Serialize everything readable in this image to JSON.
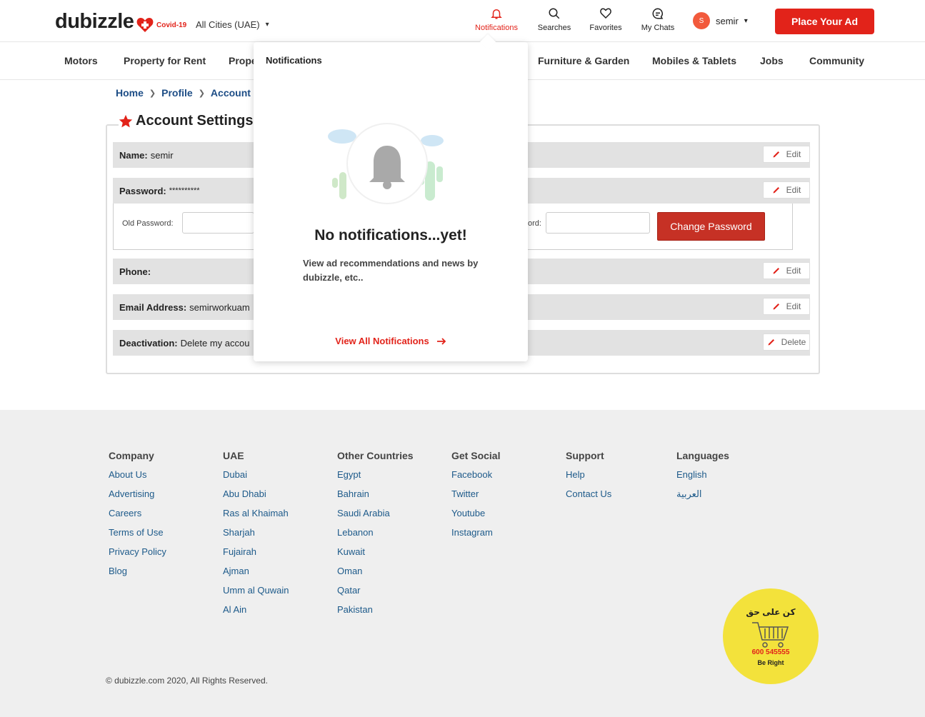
{
  "header": {
    "logo": "dubizzle",
    "covid_label": "Covid-19",
    "city": "All Cities (UAE)",
    "nav": [
      {
        "label": "Notifications",
        "icon": "bell-icon"
      },
      {
        "label": "Searches",
        "icon": "search-icon"
      },
      {
        "label": "Favorites",
        "icon": "heart-icon"
      },
      {
        "label": "My Chats",
        "icon": "chat-icon"
      }
    ],
    "user_initial": "S",
    "user_name": "semir",
    "place_ad": "Place Your Ad"
  },
  "categories": [
    "Motors",
    "Property for Rent",
    "Prope",
    "Furniture & Garden",
    "Mobiles & Tablets",
    "Jobs",
    "Community"
  ],
  "breadcrumb": [
    "Home",
    "Profile",
    "Account Set"
  ],
  "settings": {
    "title": "Account Settings",
    "rows": [
      {
        "label": "Name:",
        "value": "semir",
        "action": "Edit"
      },
      {
        "label": "Password:",
        "value": "**********",
        "action": "Edit"
      },
      {
        "label": "Phone:",
        "value": "",
        "action": "Edit"
      },
      {
        "label": "Email Address:",
        "value": "semirworkuam",
        "action": "Edit"
      },
      {
        "label": "Deactivation:",
        "value": "Delete my accou",
        "action": "Delete"
      }
    ],
    "old_password_label": "Old Password:",
    "confirm_password_label": "ord:",
    "change_password": "Change Password"
  },
  "notifications": {
    "header": "Notifications",
    "empty_title": "No notifications...yet!",
    "empty_desc": "View ad recommendations and news by dubizzle, etc..",
    "view_all": "View All Notifications"
  },
  "footer": {
    "columns": [
      {
        "title": "Company",
        "links": [
          "About Us",
          "Advertising",
          "Careers",
          "Terms of Use",
          "Privacy Policy",
          "Blog"
        ]
      },
      {
        "title": "UAE",
        "links": [
          "Dubai",
          "Abu Dhabi",
          "Ras al Khaimah",
          "Sharjah",
          "Fujairah",
          "Ajman",
          "Umm al Quwain",
          "Al Ain"
        ]
      },
      {
        "title": "Other Countries",
        "links": [
          "Egypt",
          "Bahrain",
          "Saudi Arabia",
          "Lebanon",
          "Kuwait",
          "Oman",
          "Qatar",
          "Pakistan"
        ]
      },
      {
        "title": "Get Social",
        "links": [
          "Facebook",
          "Twitter",
          "Youtube",
          "Instagram"
        ]
      },
      {
        "title": "Support",
        "links": [
          "Help",
          "Contact Us"
        ]
      },
      {
        "title": "Languages",
        "links": [
          "English",
          "العربية"
        ]
      }
    ],
    "copyright": "© dubizzle.com 2020, All Rights Reserved.",
    "badge": {
      "arabic": "كن على حق",
      "phone": "600 545555",
      "english": "Be Right"
    }
  }
}
